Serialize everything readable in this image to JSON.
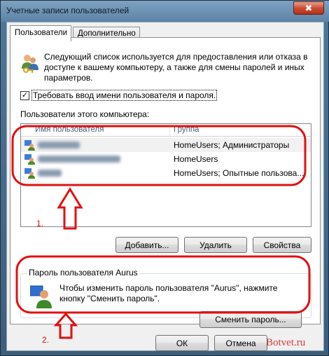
{
  "window": {
    "title": "Учетные записи пользователей",
    "close_label": "✖"
  },
  "tabs": [
    {
      "label": "Пользователи",
      "active": true
    },
    {
      "label": "Дополнительно",
      "active": false
    }
  ],
  "intro": {
    "text": "Следующий список используется для предоставления или отказа в доступе к вашему компьютеру, а также для смены паролей и иных параметров."
  },
  "require_login": {
    "label": "Требовать ввод имени пользователя и пароля.",
    "checked": true,
    "check_glyph": "✓"
  },
  "users_list": {
    "caption": "Пользователи этого компьютера:",
    "columns": [
      "Имя пользователя",
      "Группа"
    ],
    "rows": [
      {
        "group": "HomeUsers; Администраторы",
        "selected": true
      },
      {
        "group": "HomeUsers",
        "selected": false
      },
      {
        "group": "HomeUsers; Опытные пользова...",
        "selected": false
      }
    ]
  },
  "list_buttons": {
    "add": "Добавить...",
    "remove": "Удалить",
    "properties": "Свойства"
  },
  "password_group": {
    "title": "Пароль пользователя Aurus",
    "text": "Чтобы изменить пароль пользователя \"Aurus\", нажмите кнопку \"Сменить пароль\".",
    "change_button": "Сменить пароль..."
  },
  "dialog_buttons": {
    "ok": "ОК",
    "cancel": "Отмена"
  },
  "annotations": {
    "label1": "1.",
    "label2": "2.",
    "color": "#e31010"
  },
  "watermark": "Botvet.ru"
}
